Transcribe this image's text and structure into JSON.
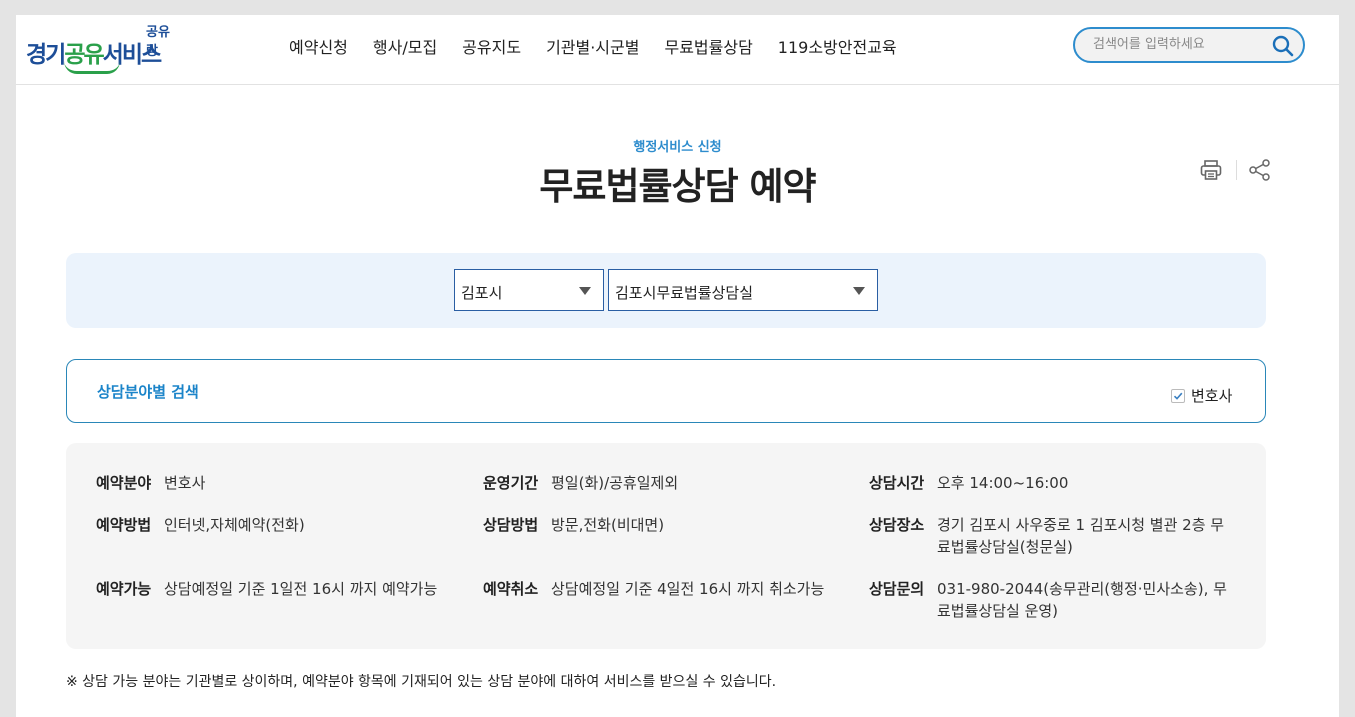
{
  "header": {
    "logo_small": "공유랑",
    "logo_part1": "경기",
    "logo_part2": "공유",
    "logo_part3": "서비스",
    "nav": [
      "예약신청",
      "행사/모집",
      "공유지도",
      "기관별·시군별",
      "무료법률상담",
      "119소방안전교육"
    ],
    "search_placeholder": "검색어를 입력하세요"
  },
  "page": {
    "subtitle": "행정서비스 신청",
    "title": "무료법률상담 예약"
  },
  "filter": {
    "city": "김포시",
    "office": "김포시무료법률상담실"
  },
  "category": {
    "label": "상담분야별 검색",
    "checkbox_label": "변호사",
    "checked": true
  },
  "info": {
    "reserve_field": {
      "label": "예약분야",
      "value": "변호사"
    },
    "operation_period": {
      "label": "운영기간",
      "value": "평일(화)/공휴일제외"
    },
    "consult_time": {
      "label": "상담시간",
      "value": "오후 14:00~16:00"
    },
    "reserve_method": {
      "label": "예약방법",
      "value": "인터넷,자체예약(전화)"
    },
    "consult_method": {
      "label": "상담방법",
      "value": "방문,전화(비대면)"
    },
    "consult_place": {
      "label": "상담장소",
      "value": "경기 김포시 사우중로 1  김포시청 별관 2층 무료법률상담실(청문실)"
    },
    "reserve_available": {
      "label": "예약가능",
      "value": "상담예정일 기준 1일전 16시 까지 예약가능"
    },
    "reserve_cancel": {
      "label": "예약취소",
      "value": "상담예정일 기준 4일전 16시 까지 취소가능"
    },
    "consult_inquiry": {
      "label": "상담문의",
      "value": "031-980-2044(송무관리(행정·민사소송), 무료법률상담실 운영)"
    }
  },
  "note": "※ 상담 가능 분야는 기관별로 상이하며, 예약분야 항목에 기재되어 있는 상담 분야에 대하여 서비스를 받으실 수 있습니다.",
  "colors": {
    "accent": "#2d8ccd",
    "brand_blue": "#1d4e98",
    "brand_green": "#2aa04a"
  }
}
